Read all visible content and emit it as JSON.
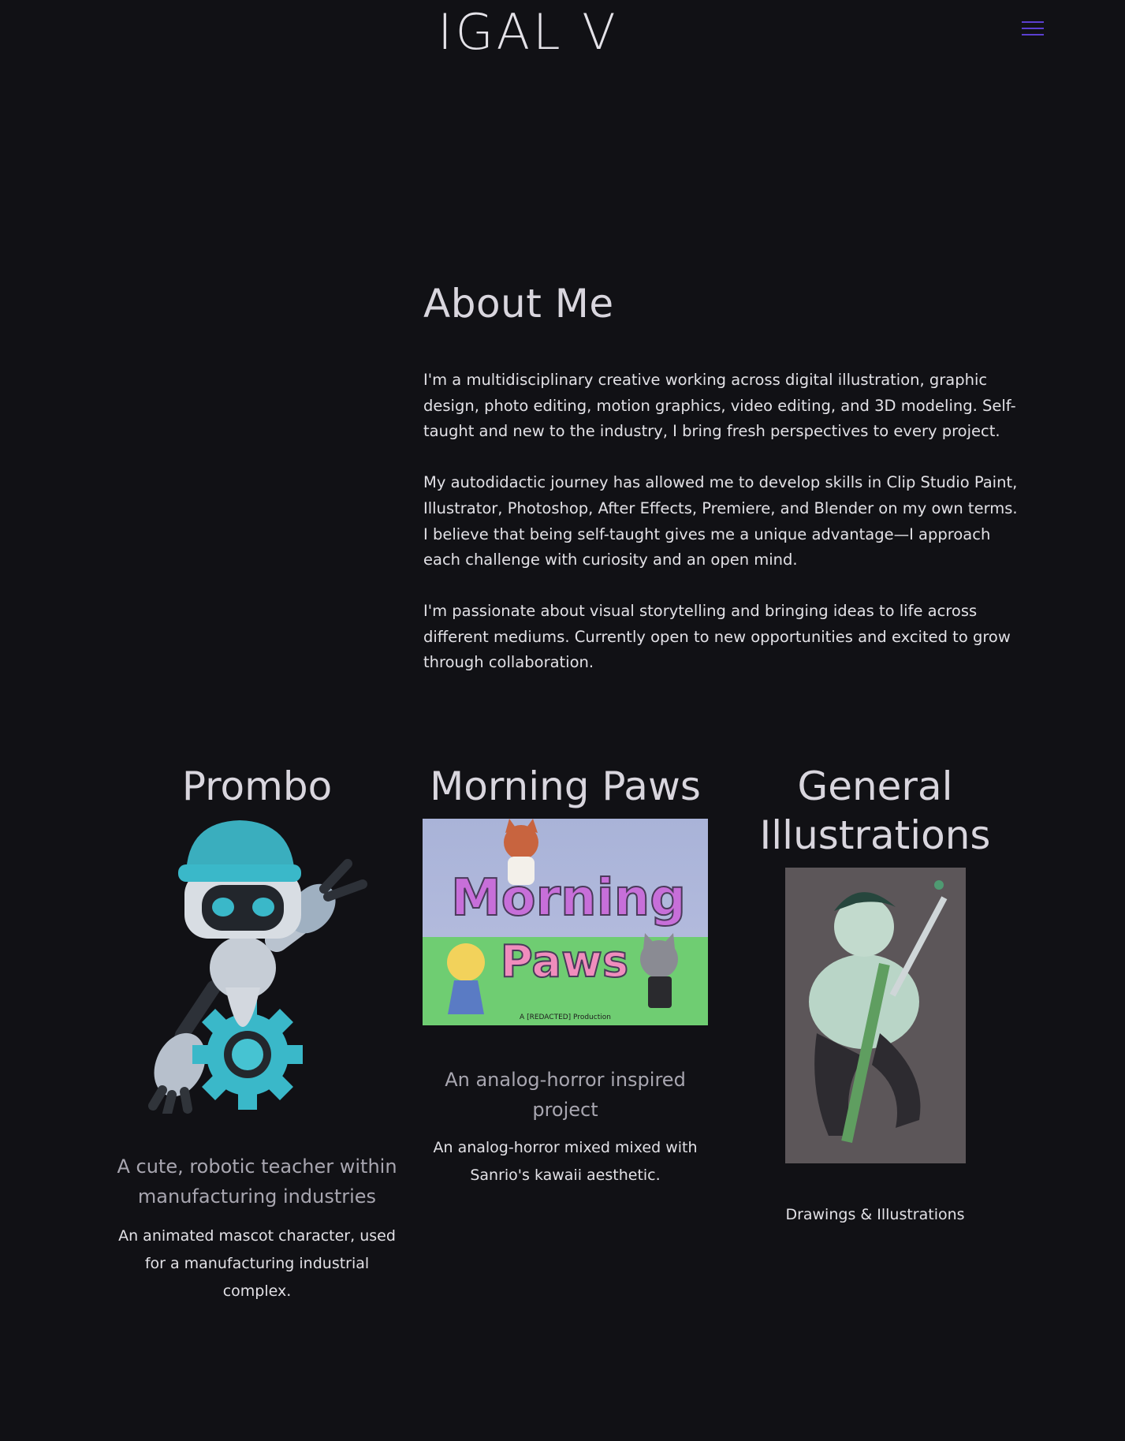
{
  "header": {
    "logo_text": "IGAL V",
    "menu_label": "Menu"
  },
  "about": {
    "title": "About Me",
    "paragraphs": [
      "I'm a multidisciplinary creative working across digital illustration, graphic design, photo editing, motion graphics, video editing, and 3D modeling. Self-taught and new to the industry, I bring fresh perspectives to every project.",
      "My autodidactic journey has allowed me to develop skills in Clip Studio Paint, Illustrator, Photoshop, After Effects, Premiere, and Blender on my own terms. I believe that being self-taught gives me a unique advantage—I approach each challenge with curiosity and an open mind.",
      "I'm passionate about visual storytelling and bringing ideas to life across different mediums. Currently open to new opportunities and excited to grow through collaboration."
    ]
  },
  "projects": [
    {
      "title": "Prombo",
      "subtitle": "A cute, robotic teacher within manufacturing industries",
      "description": "An animated mascot character, used for a manufacturing industrial complex."
    },
    {
      "title": "Morning Paws",
      "image_text_top": "Morning",
      "image_text_bottom": "Paws",
      "image_credit": "A [REDACTED] Production",
      "subtitle": "An analog-horror inspired project",
      "description": "An analog-horror mixed mixed with Sanrio's kawaii aesthetic."
    },
    {
      "title": "General Illustrations",
      "subtitle": "",
      "description": "Drawings & Illustrations"
    }
  ],
  "colors": {
    "background": "#111115",
    "accent": "#5b3fd0",
    "heading": "#d9d6de",
    "muted": "#a8a6b0"
  }
}
